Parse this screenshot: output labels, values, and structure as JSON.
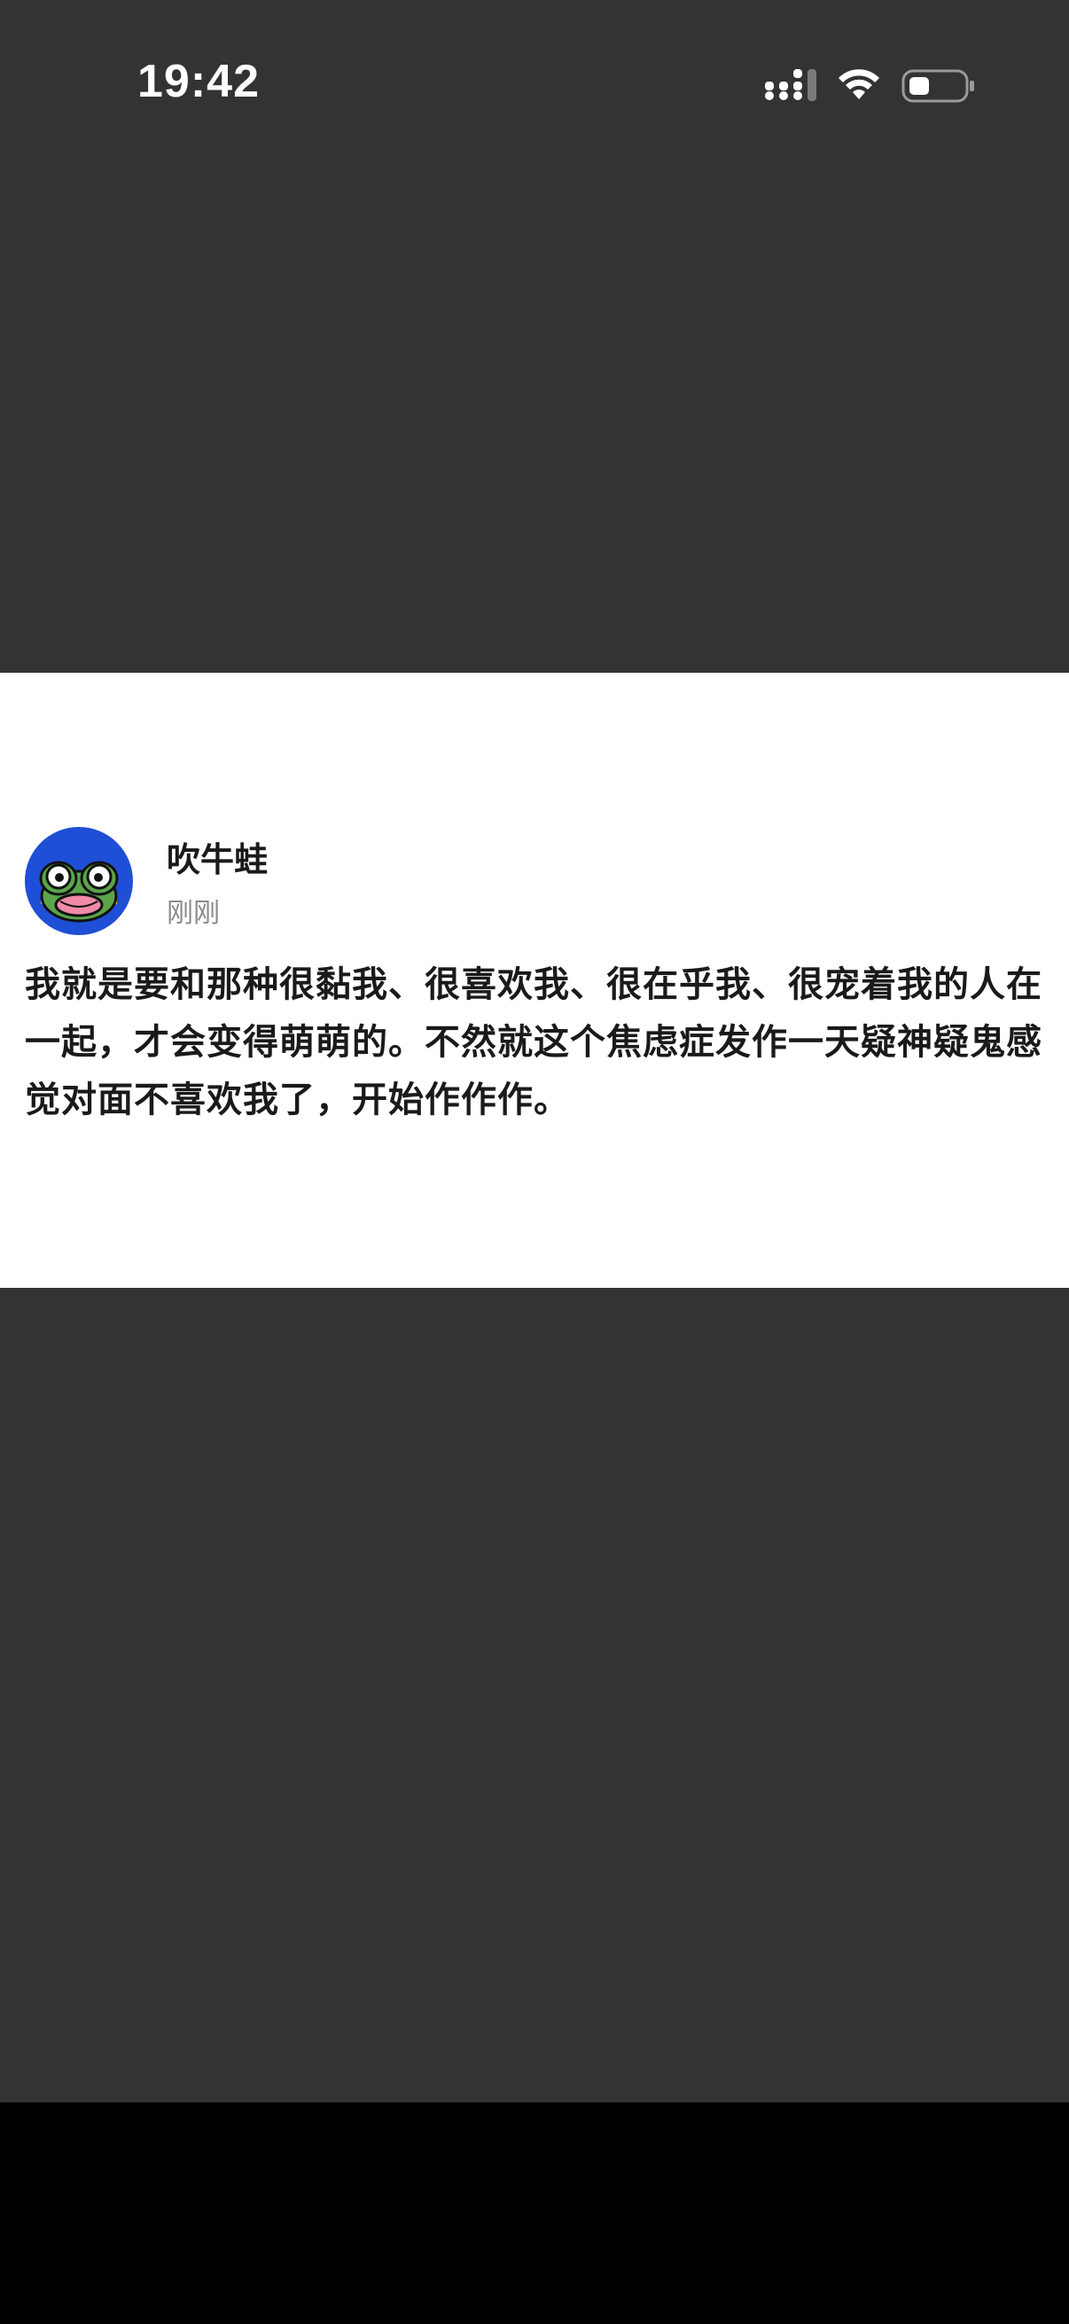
{
  "status_bar": {
    "time": "19:42",
    "icons": [
      "cellular-signal-icon",
      "wifi-icon",
      "battery-icon"
    ]
  },
  "post": {
    "author": "吹牛蛙",
    "timestamp": "刚刚",
    "avatar_icon": "frog-avatar-icon",
    "content": "我就是要和那种很黏我、很喜欢我、很在乎我、很宠着我的人在一起，才会变得萌萌的。不然就这个焦虑症发作一天疑神疑鬼感觉对面不喜欢我了，开始作作作。"
  },
  "colors": {
    "background": "#333333",
    "card": "#ffffff",
    "bottom_bar": "#000000",
    "text_primary": "#1a1a1a",
    "text_secondary": "#8a8a8a",
    "avatar_bg": "#1f4fd6"
  }
}
